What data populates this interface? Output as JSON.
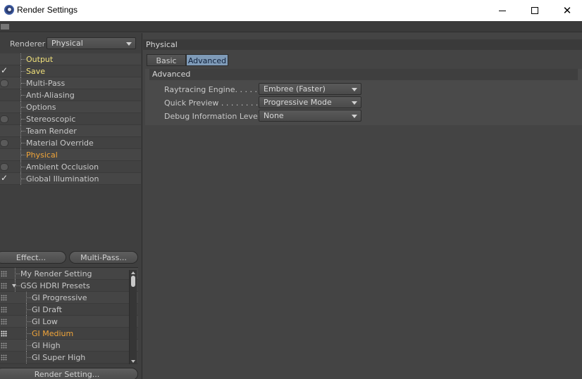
{
  "window": {
    "title": "Render Settings",
    "controls": {
      "minimize": "minimize",
      "maximize": "maximize",
      "close": "✕"
    }
  },
  "left": {
    "renderer_label": "Renderer",
    "renderer_value": "Physical",
    "settings": [
      {
        "name": "Output",
        "check": "none",
        "color": "yellow"
      },
      {
        "name": "Save",
        "check": "tick",
        "color": "yellow"
      },
      {
        "name": "Multi-Pass",
        "check": "radio",
        "color": "normal"
      },
      {
        "name": "Anti-Aliasing",
        "check": "none",
        "color": "normal"
      },
      {
        "name": "Options",
        "check": "none",
        "color": "normal"
      },
      {
        "name": "Stereoscopic",
        "check": "radio",
        "color": "normal"
      },
      {
        "name": "Team Render",
        "check": "none",
        "color": "normal"
      },
      {
        "name": "Material Override",
        "check": "radio",
        "color": "normal"
      },
      {
        "name": "Physical",
        "check": "none",
        "color": "orange"
      },
      {
        "name": "Ambient Occlusion",
        "check": "radio",
        "color": "normal"
      },
      {
        "name": "Global Illumination",
        "check": "tick",
        "color": "normal"
      }
    ],
    "effect_button": "Effect...",
    "multipass_button": "Multi-Pass...",
    "presets": [
      {
        "name": "My Render Setting",
        "level": 0,
        "expanded": false,
        "active": false
      },
      {
        "name": "GSG HDRI Presets",
        "level": 0,
        "expanded": true,
        "active": false
      },
      {
        "name": "GI Progressive",
        "level": 1,
        "expanded": false,
        "active": false
      },
      {
        "name": "GI Draft",
        "level": 1,
        "expanded": false,
        "active": false
      },
      {
        "name": "GI Low",
        "level": 1,
        "expanded": false,
        "active": false
      },
      {
        "name": "GI Medium",
        "level": 1,
        "expanded": false,
        "active": true
      },
      {
        "name": "GI High",
        "level": 1,
        "expanded": false,
        "active": false
      },
      {
        "name": "GI Super High",
        "level": 1,
        "expanded": false,
        "active": false
      }
    ],
    "render_setting_button": "Render Setting..."
  },
  "right": {
    "section_title": "Physical",
    "tabs": [
      {
        "label": "Basic",
        "active": false
      },
      {
        "label": "Advanced",
        "active": true
      }
    ],
    "group_title": "Advanced",
    "fields": [
      {
        "label": "Raytracing Engine. . . . . .",
        "value": "Embree (Faster)"
      },
      {
        "label": "Quick Preview . . . . . . . . .",
        "value": "Progressive Mode"
      },
      {
        "label": "Debug Information Level",
        "value": "None"
      }
    ]
  },
  "colors": {
    "active_tab": "#7f9bb8",
    "highlight_text": "#f0a53a",
    "yellow_text": "#f0e07a",
    "panel_bg": "#444444"
  }
}
